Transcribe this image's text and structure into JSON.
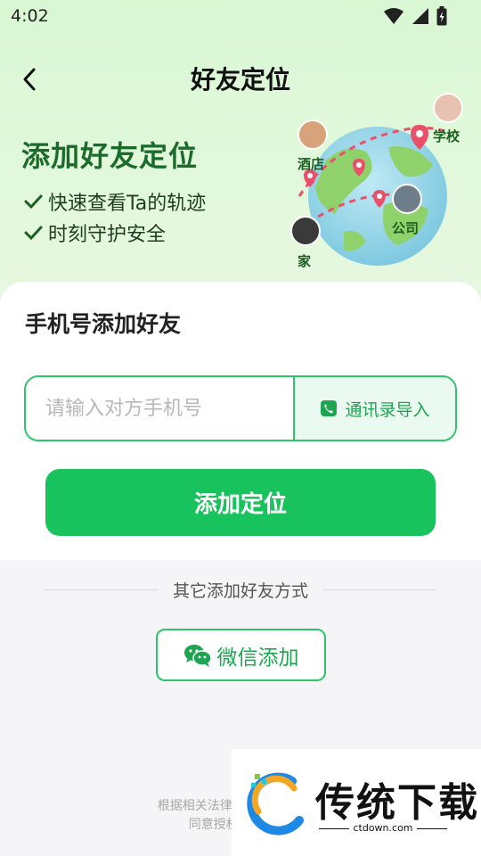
{
  "status_bar": {
    "time": "4:02"
  },
  "header": {
    "title": "好友定位"
  },
  "promo": {
    "title": "添加好友定位",
    "features": [
      "快速查看Ta的轨迹",
      "时刻守护安全"
    ],
    "map_labels": {
      "school": "学校",
      "hotel": "酒店",
      "company": "公司",
      "home": "家"
    }
  },
  "phone_section": {
    "title": "手机号添加好友",
    "input_placeholder": "请输入对方手机号",
    "input_value": "",
    "contacts_button": "通讯录导入",
    "submit_button": "添加定位"
  },
  "other_section": {
    "label": "其它添加好友方式",
    "wechat_button": "微信添加"
  },
  "disclaimer": {
    "line1": "根据相关法律和隐私政策规定,",
    "line2": "同意授权,不得在对"
  },
  "watermark": {
    "brand": "传统下载",
    "url": "ctdown.com"
  },
  "colors": {
    "primary": "#18c25c",
    "accent_border": "#2ec56a",
    "hero_bg": "#dcf7d6",
    "promo_title": "#1b6b2d"
  },
  "icons": [
    "back-arrow-icon",
    "wifi-icon",
    "signal-icon",
    "battery-icon",
    "check-icon",
    "phone-book-icon",
    "wechat-icon",
    "location-pin-icon"
  ]
}
